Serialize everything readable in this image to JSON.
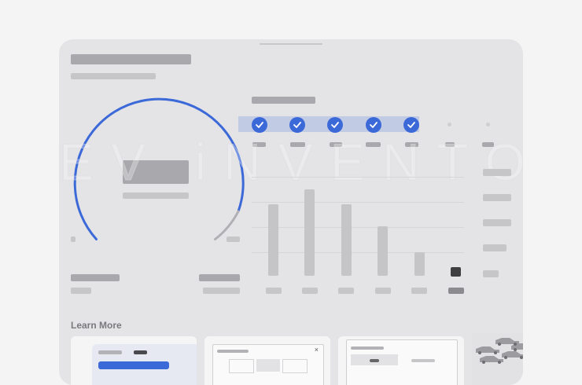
{
  "watermark": "EV iNVENTORY",
  "learn_more": {
    "title": "Learn More"
  },
  "dialog_close": "×",
  "colors": {
    "accent": "#3c69d8",
    "panel": "#e4e4e6",
    "page": "#f4f4f5",
    "marker": "#3f3f42"
  },
  "steps": {
    "completed": 5,
    "pending": 2
  },
  "icons": [
    "check-icon",
    "close-icon",
    "car-photo"
  ]
}
